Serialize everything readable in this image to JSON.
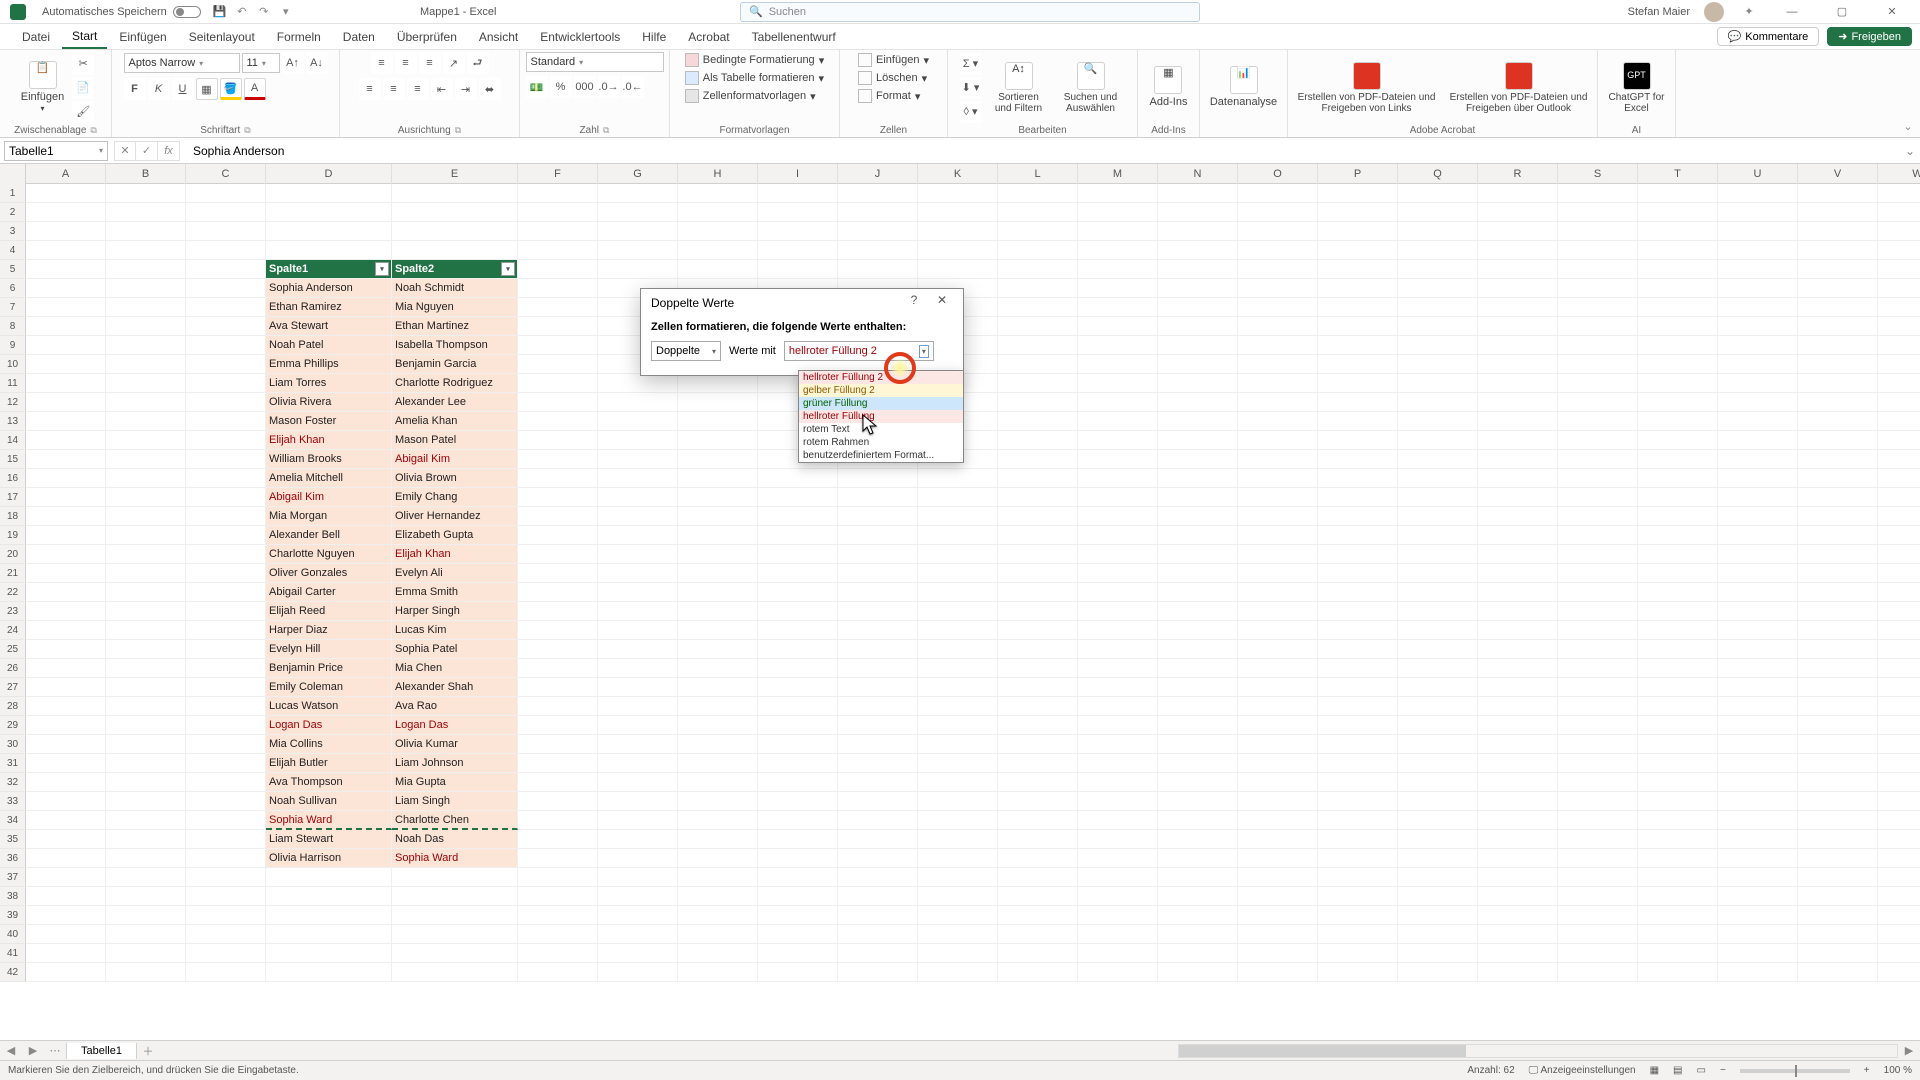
{
  "titlebar": {
    "autosave_label": "Automatisches Speichern",
    "doc_title": "Mappe1 - Excel",
    "search_placeholder": "Suchen",
    "user_name": "Stefan Maier"
  },
  "menu": {
    "tabs": [
      "Datei",
      "Start",
      "Einfügen",
      "Seitenlayout",
      "Formeln",
      "Daten",
      "Überprüfen",
      "Ansicht",
      "Entwicklertools",
      "Hilfe",
      "Acrobat",
      "Tabellenentwurf"
    ],
    "active": "Start",
    "comments": "Kommentare",
    "share": "Freigeben"
  },
  "ribbon": {
    "clipboard": {
      "paste": "Einfügen",
      "label": "Zwischenablage"
    },
    "font": {
      "name": "Aptos Narrow",
      "size": "11",
      "label": "Schriftart"
    },
    "align": {
      "label": "Ausrichtung"
    },
    "number": {
      "format": "Standard",
      "label": "Zahl"
    },
    "styles": {
      "cond": "Bedingte Formatierung",
      "table": "Als Tabelle formatieren",
      "cell": "Zellenformatvorlagen",
      "label": "Formatvorlagen"
    },
    "cells": {
      "insert": "Einfügen",
      "delete": "Löschen",
      "format": "Format",
      "label": "Zellen"
    },
    "edit": {
      "sort": "Sortieren und Filtern",
      "find": "Suchen und Auswählen",
      "label": "Bearbeiten"
    },
    "addins": {
      "btn": "Add-Ins",
      "label": "Add-Ins"
    },
    "analysis": {
      "btn": "Datenanalyse"
    },
    "acrobat": {
      "b1": "Erstellen von PDF-Dateien und Freigeben von Links",
      "b2": "Erstellen von PDF-Dateien und Freigeben über Outlook",
      "label": "Adobe Acrobat"
    },
    "ai": {
      "btn": "ChatGPT for Excel",
      "label": "AI"
    }
  },
  "fx": {
    "namebox": "Tabelle1",
    "formula": "Sophia Anderson"
  },
  "columns": [
    "A",
    "B",
    "C",
    "D",
    "E",
    "F",
    "G",
    "H",
    "I",
    "J",
    "K",
    "L",
    "M",
    "N",
    "O",
    "P",
    "Q",
    "R",
    "S",
    "T",
    "U",
    "V",
    "W"
  ],
  "table": {
    "header": [
      "Spalte1",
      "Spalte2"
    ],
    "rows": [
      [
        "Sophia Anderson",
        "Noah Schmidt"
      ],
      [
        "Ethan Ramirez",
        "Mia Nguyen"
      ],
      [
        "Ava Stewart",
        "Ethan Martinez"
      ],
      [
        "Noah Patel",
        "Isabella Thompson"
      ],
      [
        "Emma Phillips",
        "Benjamin Garcia"
      ],
      [
        "Liam Torres",
        "Charlotte Rodriguez"
      ],
      [
        "Olivia Rivera",
        "Alexander Lee"
      ],
      [
        "Mason Foster",
        "Amelia Khan"
      ],
      [
        "Elijah Khan",
        "Mason Patel"
      ],
      [
        "William Brooks",
        "Abigail Kim"
      ],
      [
        "Amelia Mitchell",
        "Olivia Brown"
      ],
      [
        "Abigail Kim",
        "Emily Chang"
      ],
      [
        "Mia Morgan",
        "Oliver Hernandez"
      ],
      [
        "Alexander Bell",
        "Elizabeth Gupta"
      ],
      [
        "Charlotte Nguyen",
        "Elijah Khan"
      ],
      [
        "Oliver Gonzales",
        "Evelyn Ali"
      ],
      [
        "Abigail Carter",
        "Emma Smith"
      ],
      [
        "Elijah Reed",
        "Harper Singh"
      ],
      [
        "Harper Diaz",
        "Lucas Kim"
      ],
      [
        "Evelyn Hill",
        "Sophia Patel"
      ],
      [
        "Benjamin Price",
        "Mia Chen"
      ],
      [
        "Emily Coleman",
        "Alexander Shah"
      ],
      [
        "Lucas Watson",
        "Ava Rao"
      ],
      [
        "Logan Das",
        "Logan Das"
      ],
      [
        "Mia Collins",
        "Olivia Kumar"
      ],
      [
        "Elijah Butler",
        "Liam Johnson"
      ],
      [
        "Ava Thompson",
        "Mia Gupta"
      ],
      [
        "Noah Sullivan",
        "Liam Singh"
      ],
      [
        "Sophia Ward",
        "Charlotte Chen"
      ],
      [
        "Liam Stewart",
        "Noah Das"
      ],
      [
        "Olivia Harrison",
        "Sophia Ward"
      ]
    ],
    "dup_cells": [
      [
        8,
        0
      ],
      [
        9,
        1
      ],
      [
        11,
        0
      ],
      [
        14,
        1
      ],
      [
        23,
        0
      ],
      [
        23,
        1
      ],
      [
        28,
        0
      ],
      [
        30,
        1
      ]
    ]
  },
  "dialog": {
    "title": "Doppelte Werte",
    "subtitle": "Zellen formatieren, die folgende Werte enthalten:",
    "mode": "Doppelte",
    "with": "Werte mit",
    "format": "hellroter Füllung 2",
    "options": [
      "hellroter Füllung 2",
      "gelber Füllung 2",
      "grüner Füllung",
      "hellroter Füllung",
      "rotem Text",
      "rotem Rahmen",
      "benutzerdefiniertem Format..."
    ],
    "hover_index": 2
  },
  "sheet": {
    "name": "Tabelle1"
  },
  "status": {
    "msg": "Markieren Sie den Zielbereich, und drücken Sie die Eingabetaste.",
    "count_label": "Anzahl:",
    "count": "62",
    "display": "Anzeigeeinstellungen",
    "zoom": "100 %"
  }
}
